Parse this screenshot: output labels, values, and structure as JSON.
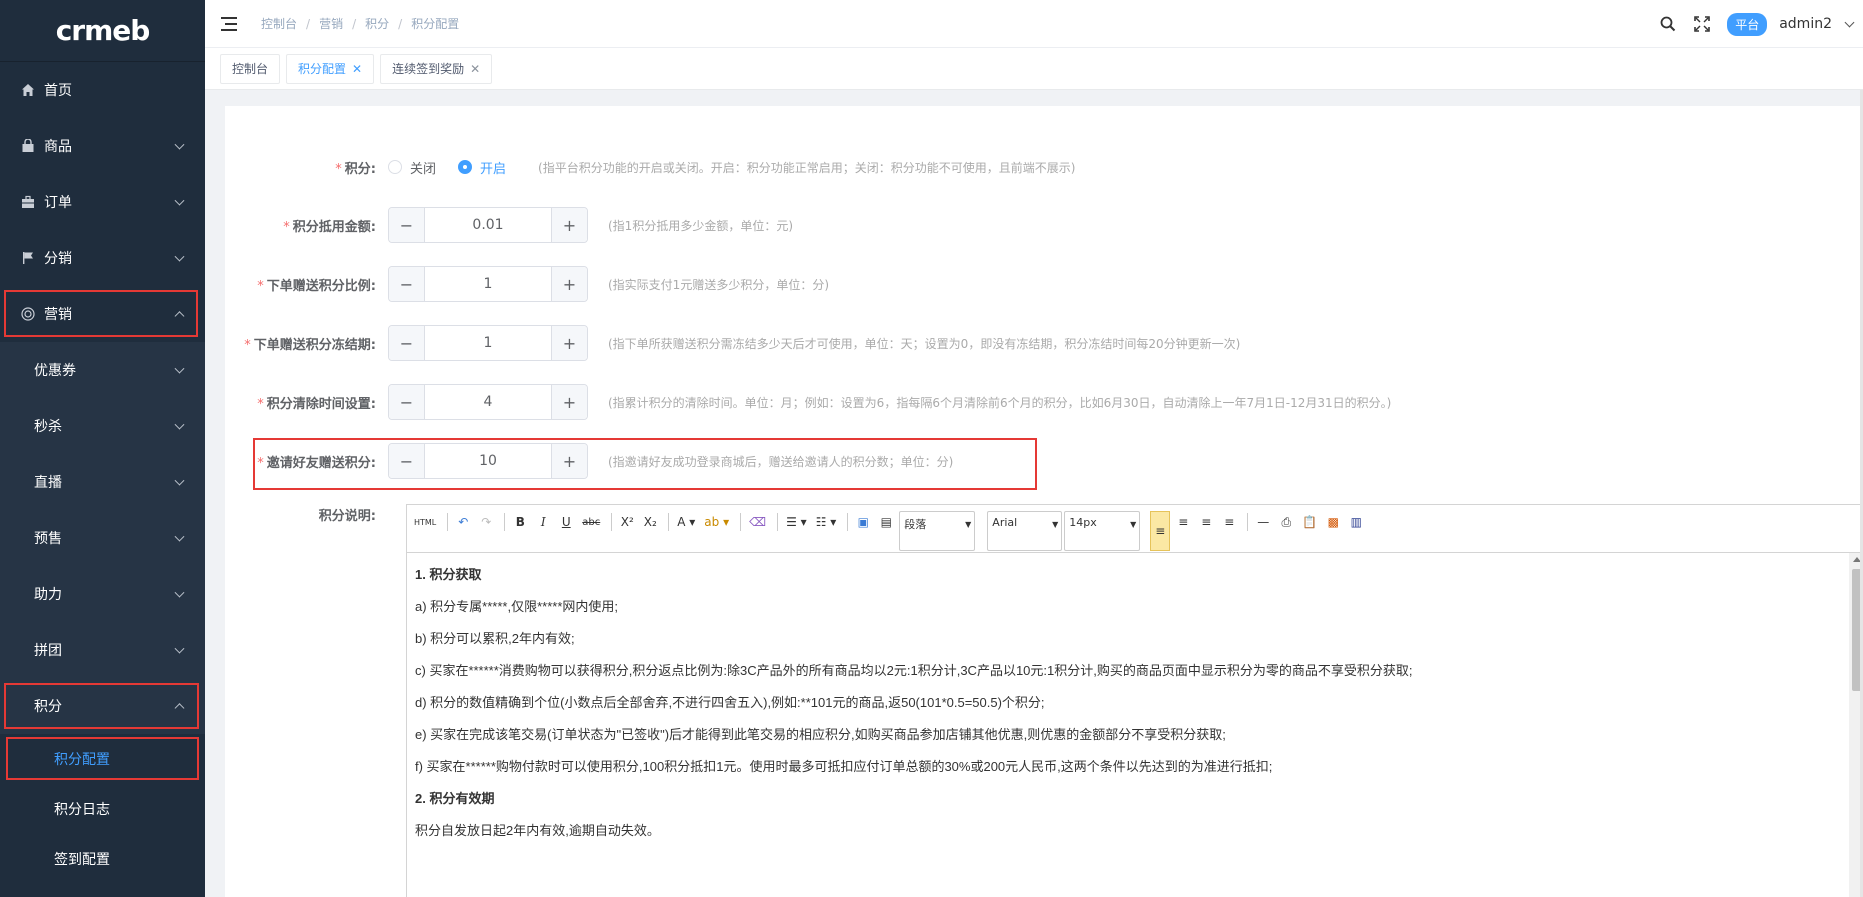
{
  "brand": {
    "logo": "crmeb"
  },
  "sidebar": {
    "items": [
      {
        "label": "首页",
        "icon": "home-icon"
      },
      {
        "label": "商品",
        "icon": "shop-bag-icon"
      },
      {
        "label": "订单",
        "icon": "briefcase-icon"
      },
      {
        "label": "分销",
        "icon": "flag-icon"
      },
      {
        "label": "营销",
        "icon": "target-icon"
      }
    ],
    "marketing_children": [
      "优惠券",
      "秒杀",
      "直播",
      "预售",
      "助力",
      "拼团",
      "积分"
    ],
    "points_children": [
      "积分配置",
      "积分日志",
      "签到配置"
    ]
  },
  "breadcrumb": [
    "控制台",
    "营销",
    "积分",
    "积分配置"
  ],
  "topbar": {
    "badge": "平台",
    "user": "admin2"
  },
  "tabs": [
    {
      "label": "控制台"
    },
    {
      "label": "积分配置"
    },
    {
      "label": "连续签到奖励"
    }
  ],
  "form": {
    "switch": {
      "label": "积分:",
      "off_label": "关闭",
      "on_label": "开启",
      "selected": "开启",
      "hint": "(指平台积分功能的开启或关闭。开启：积分功能正常启用；关闭：积分功能不可使用，且前端不展示)"
    },
    "fields": [
      {
        "label": "积分抵用金额:",
        "value": "0.01",
        "hint": "(指1积分抵用多少金额，单位：元)"
      },
      {
        "label": "下单赠送积分比例:",
        "value": "1",
        "hint": "(指实际支付1元赠送多少积分，单位：分)"
      },
      {
        "label": "下单赠送积分冻结期:",
        "value": "1",
        "hint": "(指下单所获赠送积分需冻结多少天后才可使用，单位：天；设置为0，即没有冻结期，积分冻结时间每20分钟更新一次)"
      },
      {
        "label": "积分清除时间设置:",
        "value": "4",
        "hint": "(指累计积分的清除时间。单位：月；例如：设置为6，指每隔6个月清除前6个月的积分，比如6月30日，自动清除上一年7月1日-12月31日的积分。)"
      },
      {
        "label": "邀请好友赠送积分:",
        "value": "10",
        "hint": "(指邀请好友成功登录商城后，赠送给邀请人的积分数；单位：分)"
      }
    ],
    "description": {
      "label": "积分说明:",
      "toolbar": {
        "html": "HTML",
        "paragraph": "段落",
        "font": "Arial",
        "size": "14px"
      },
      "paragraphs": [
        {
          "text": "1. 积分获取",
          "bold": true
        },
        {
          "text": "a)  积分专属*****,仅限*****网内使用;",
          "bold": false
        },
        {
          "text": "b)  积分可以累积,2年内有效;",
          "bold": false
        },
        {
          "text": "c)  买家在******消费购物可以获得积分,积分返点比例为:除3C产品外的所有商品均以2元:1积分计,3C产品以10元:1积分计,购买的商品页面中显示积分为零的商品不享受积分获取;",
          "bold": false
        },
        {
          "text": "d)  积分的数值精确到个位(小数点后全部舍弃,不进行四舍五入),例如:**101元的商品,返50(101*0.5=50.5)个积分;",
          "bold": false
        },
        {
          "text": "e)  买家在完成该笔交易(订单状态为\"已签收\")后才能得到此笔交易的相应积分,如购买商品参加店铺其他优惠,则优惠的金额部分不享受积分获取;",
          "bold": false
        },
        {
          "text": "f)  买家在******购物付款时可以使用积分,100积分抵扣1元。使用时最多可抵扣应付订单总额的30%或200元人民币,这两个条件以先达到的为准进行抵扣;",
          "bold": false
        },
        {
          "text": "2. 积分有效期",
          "bold": true
        },
        {
          "text": "积分自发放日起2年内有效,逾期自动失效。",
          "bold": false
        }
      ]
    }
  }
}
